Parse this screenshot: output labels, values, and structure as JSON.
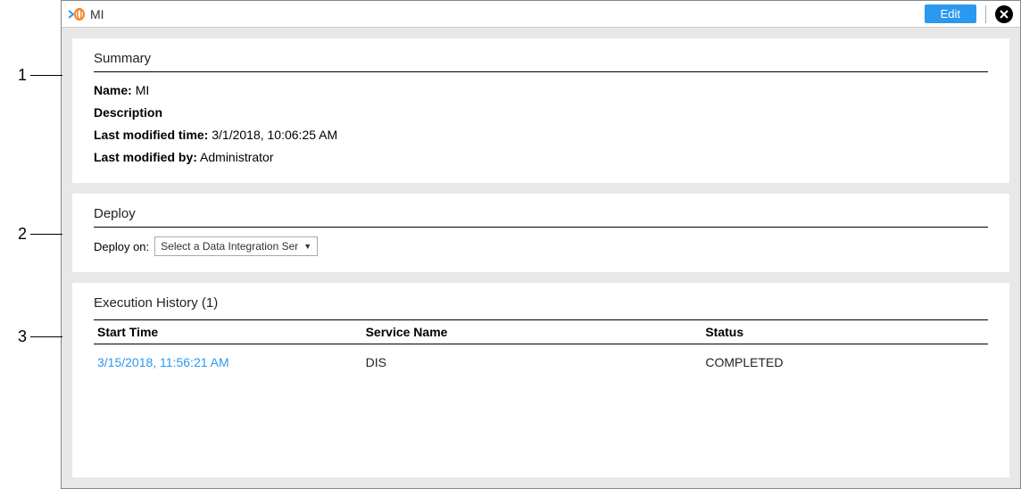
{
  "annotations": {
    "a1": "1",
    "a2": "2",
    "a3": "3"
  },
  "header": {
    "title": "MI",
    "edit_label": "Edit"
  },
  "summary": {
    "title": "Summary",
    "name_label": "Name:",
    "name_value": "MI",
    "description_label": "Description",
    "modified_time_label": "Last modified time:",
    "modified_time_value": "3/1/2018, 10:06:25 AM",
    "modified_by_label": "Last modified by:",
    "modified_by_value": "Administrator"
  },
  "deploy": {
    "title": "Deploy",
    "deploy_on_label": "Deploy on:",
    "select_placeholder": "Select a Data Integration Ser"
  },
  "history": {
    "title": "Execution History (1)",
    "columns": {
      "start_time": "Start Time",
      "service_name": "Service Name",
      "status": "Status"
    },
    "rows": [
      {
        "start_time": "3/15/2018, 11:56:21 AM",
        "service_name": "DIS",
        "status": "COMPLETED"
      }
    ]
  }
}
